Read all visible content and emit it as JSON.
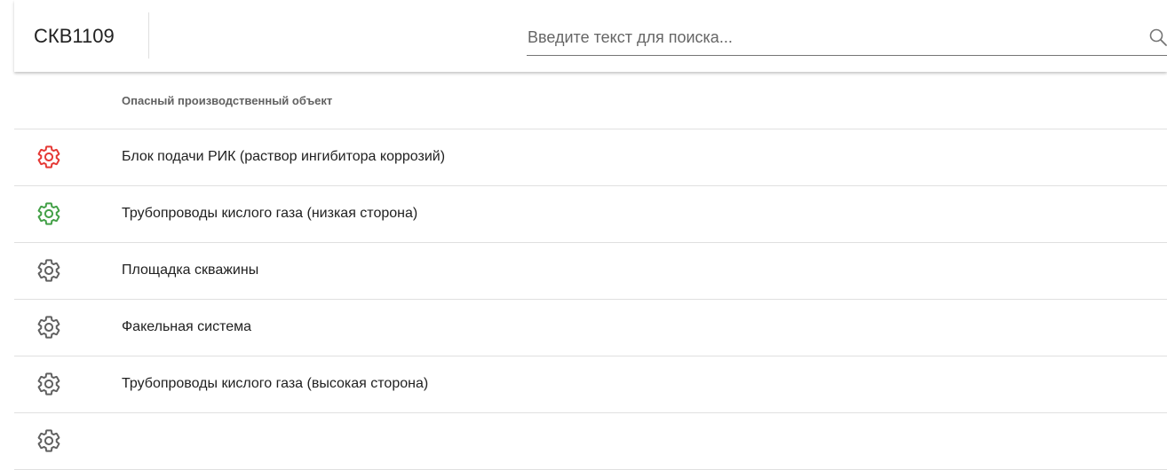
{
  "header": {
    "title": "СКВ1109"
  },
  "search": {
    "placeholder": "Введите текст для поиска...",
    "value": "",
    "icon": "search-icon"
  },
  "table": {
    "column_header": "Опасный производственный объект",
    "rows": [
      {
        "label": "Блок подачи РИК (раствор ингибитора коррозий)",
        "icon": "gear-icon",
        "status_color": "#e53935"
      },
      {
        "label": "Трубопроводы кислого газа (низкая сторона)",
        "icon": "gear-icon",
        "status_color": "#43a047"
      },
      {
        "label": "Площадка скважины",
        "icon": "gear-icon",
        "status_color": "#616161"
      },
      {
        "label": "Факельная система",
        "icon": "gear-icon",
        "status_color": "#616161"
      },
      {
        "label": "Трубопроводы кислого газа (высокая сторона)",
        "icon": "gear-icon",
        "status_color": "#616161"
      },
      {
        "label": "",
        "icon": "gear-icon",
        "status_color": "#616161"
      }
    ]
  }
}
